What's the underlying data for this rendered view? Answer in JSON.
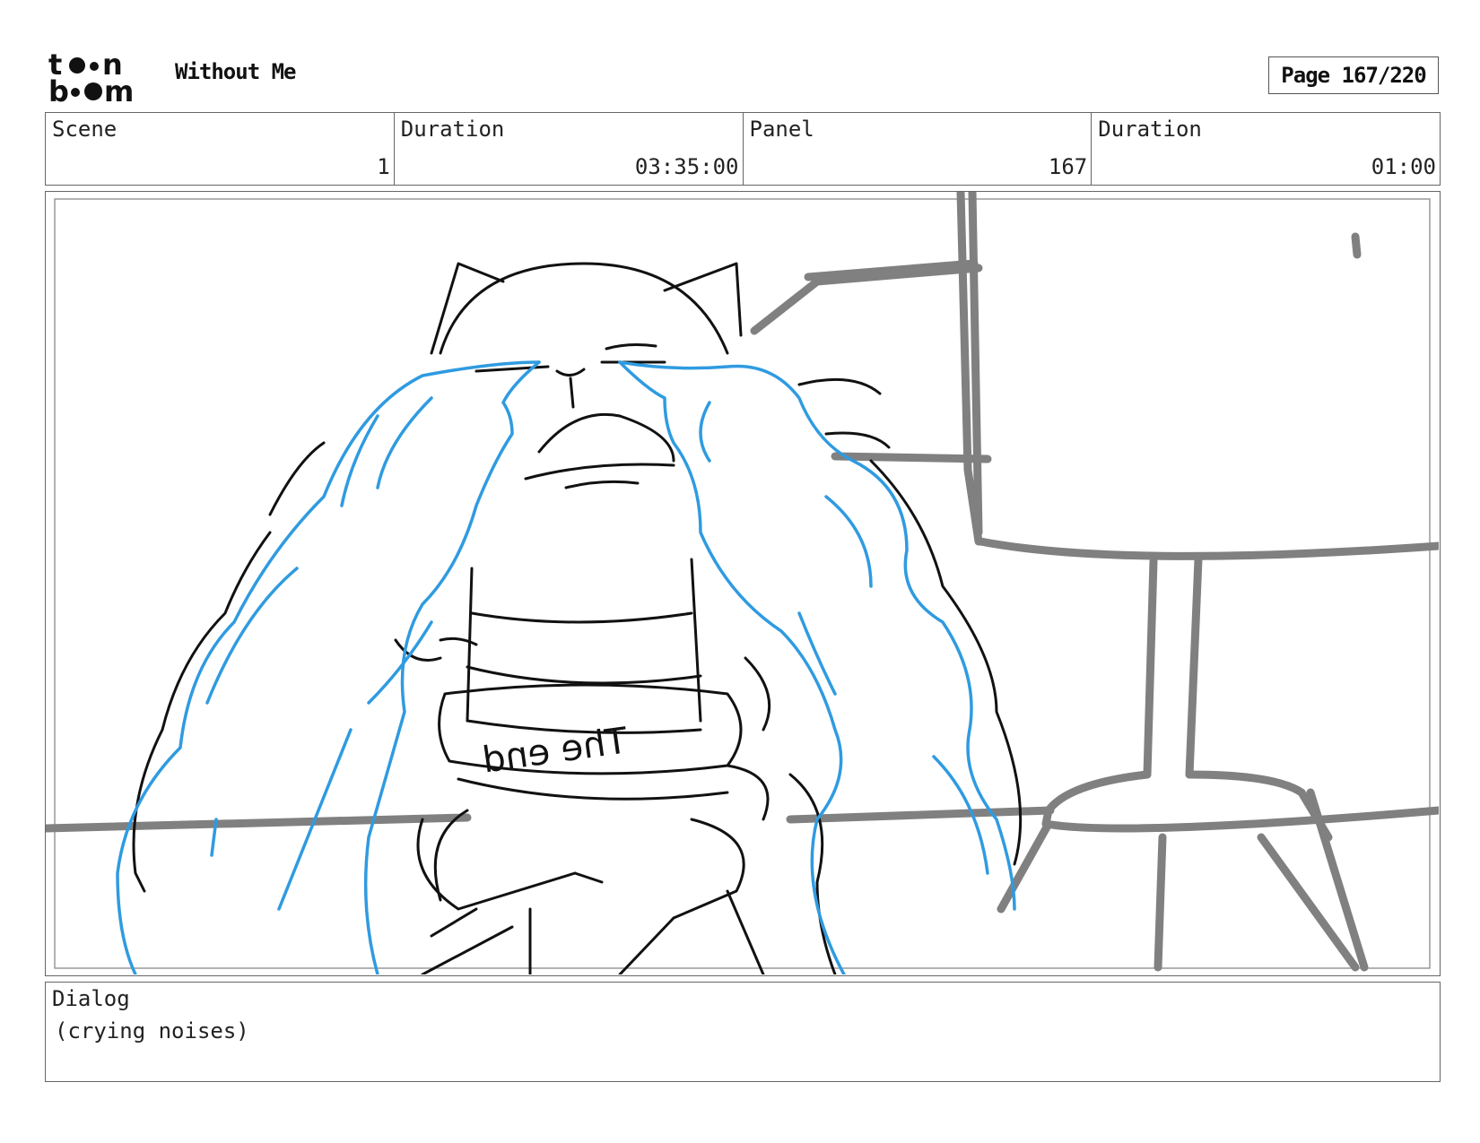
{
  "header": {
    "logo_text": "toon boom",
    "title": "Without Me",
    "page_label": "Page 167/220"
  },
  "info": {
    "scene_label": "Scene",
    "scene_value": "1",
    "duration_label": "Duration",
    "duration_value": "03:35:00",
    "panel_label": "Panel",
    "panel_value": "167",
    "panel_duration_label": "Duration",
    "panel_duration_value": "01:00"
  },
  "panel": {
    "shirt_text": "The end",
    "colors": {
      "sketch": "#111111",
      "tears": "#2f9be0",
      "background": "#808080"
    }
  },
  "dialog": {
    "label": "Dialog",
    "text": "(crying noises)"
  }
}
